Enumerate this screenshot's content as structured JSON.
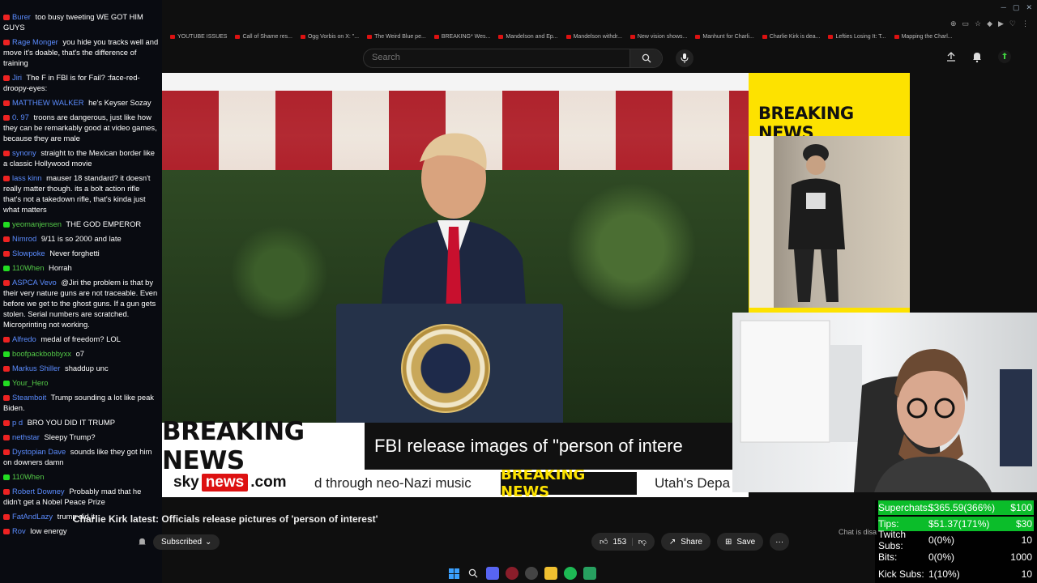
{
  "browser": {
    "bookmarks": [
      "YOUTUBE ISSUES",
      "Call of Shame res...",
      "Ogg Vorbis on X: \"...",
      "The Weird Blue pe...",
      "BREAKING* Wes...",
      "Mandelson and Ep...",
      "Mandelson withdr...",
      "New vision shows...",
      "Manhunt for Charli...",
      "Charlie Kirk is dea...",
      "Lefties Losing It: T...",
      "Mapping the Charl..."
    ]
  },
  "youtube": {
    "search_placeholder": "Search",
    "video_title": "Charlie Kirk latest: Officials release pictures of 'person of interest'",
    "subscribed_label": "Subscribed",
    "likes": "153",
    "share_label": "Share",
    "save_label": "Save",
    "chat_disabled": "Chat is disa"
  },
  "broadcast": {
    "lower_third_label": "BREAKING NEWS",
    "headline": "FBI release images of \"person of intere",
    "logo_sky": "sky",
    "logo_news": "news",
    "logo_com": ".com",
    "ticker_text_1": "d through neo-Nazi music",
    "ticker_label": "BREAKING NEWS",
    "ticker_text_2": "Utah's Depa",
    "side_panel_title": "BREAKING NEWS"
  },
  "chat": [
    {
      "platform": "yt",
      "user": "Burer",
      "text": "too busy tweeting WE GOT HIM GUYS"
    },
    {
      "platform": "yt",
      "user": "Rage Monger",
      "text": "you hide you tracks well and move it's doable, that's the difference of training"
    },
    {
      "platform": "yt",
      "user": "Jiri",
      "text": "The F in FBI is for Fail? :face-red-droopy-eyes:"
    },
    {
      "platform": "yt",
      "user": "MATTHEW WALKER",
      "text": "he's Keyser Sozay"
    },
    {
      "platform": "yt",
      "user": "0. 97",
      "text": "troons are dangerous, just like how they can be remarkably good at video games, because they are male"
    },
    {
      "platform": "yt",
      "user": "synony",
      "text": "straight to the Mexican border like a classic Hollywood movie"
    },
    {
      "platform": "yt",
      "user": "lass kinn",
      "text": "mauser 18 standard? it doesn't really matter though. its a bolt action rifle that's not a takedown rifle, that's kinda just what matters"
    },
    {
      "platform": "kick",
      "user": "yeomanjensen",
      "text": "THE GOD EMPEROR"
    },
    {
      "platform": "yt",
      "user": "Nimrod",
      "text": "9/11 is so 2000 and late"
    },
    {
      "platform": "yt",
      "user": "Slowpoke",
      "text": "Never forghetti"
    },
    {
      "platform": "kick",
      "user": "110When",
      "text": "Horrah"
    },
    {
      "platform": "yt",
      "user": "ASPCA Vevo",
      "text": "@Jiri the problem is that by their very nature guns are not traceable. Even before we get to the ghost guns. If a gun gets stolen. Serial numbers are scratched. Microprinting not working."
    },
    {
      "platform": "yt",
      "user": "Alfredo",
      "text": "medal of freedom? LOL"
    },
    {
      "platform": "kick",
      "user": "boofpackbobbyxx",
      "text": "o7"
    },
    {
      "platform": "yt",
      "user": "Markus Shiller",
      "text": "shaddup unc"
    },
    {
      "platform": "kick",
      "user": "Your_Hero",
      "text": ""
    },
    {
      "platform": "yt",
      "user": "Steamboit",
      "text": "Trump sounding a lot like peak Biden."
    },
    {
      "platform": "yt",
      "user": "p d",
      "text": "BRO YOU DID IT TRUMP"
    },
    {
      "platform": "yt",
      "user": "nethstar",
      "text": "Sleepy Trump?"
    },
    {
      "platform": "yt",
      "user": "Dystopian Dave",
      "text": "sounds like they got him on downers damn"
    },
    {
      "platform": "kick",
      "user": "110When",
      "text": ""
    },
    {
      "platform": "yt",
      "user": "Robert Downey",
      "text": "Probably mad that he didn't get a Nobel Peace Prize"
    },
    {
      "platform": "yt",
      "user": "FatAndLazy",
      "text": "trump did it"
    },
    {
      "platform": "yt",
      "user": "Rov",
      "text": "low energy"
    }
  ],
  "stats": {
    "rows": [
      {
        "label": "Superchats:",
        "value": "$365.59(366%)",
        "goal": "$100",
        "highlight": true
      },
      {
        "label": "Tips:",
        "value": "$51.37(171%)",
        "goal": "$30",
        "highlight": true
      },
      {
        "label": "Twitch Subs:",
        "value": "0(0%)",
        "goal": "10",
        "highlight": false
      },
      {
        "label": "Bits:",
        "value": "0(0%)",
        "goal": "1000",
        "highlight": false
      },
      {
        "label": "Kick Subs:",
        "value": "1(10%)",
        "goal": "10",
        "highlight": false
      }
    ]
  },
  "colors": {
    "yt_user": "#5b8cff",
    "kick_user": "#53c947",
    "stat_highlight": "#0bbd2a",
    "breaking_yellow": "#fde200"
  }
}
